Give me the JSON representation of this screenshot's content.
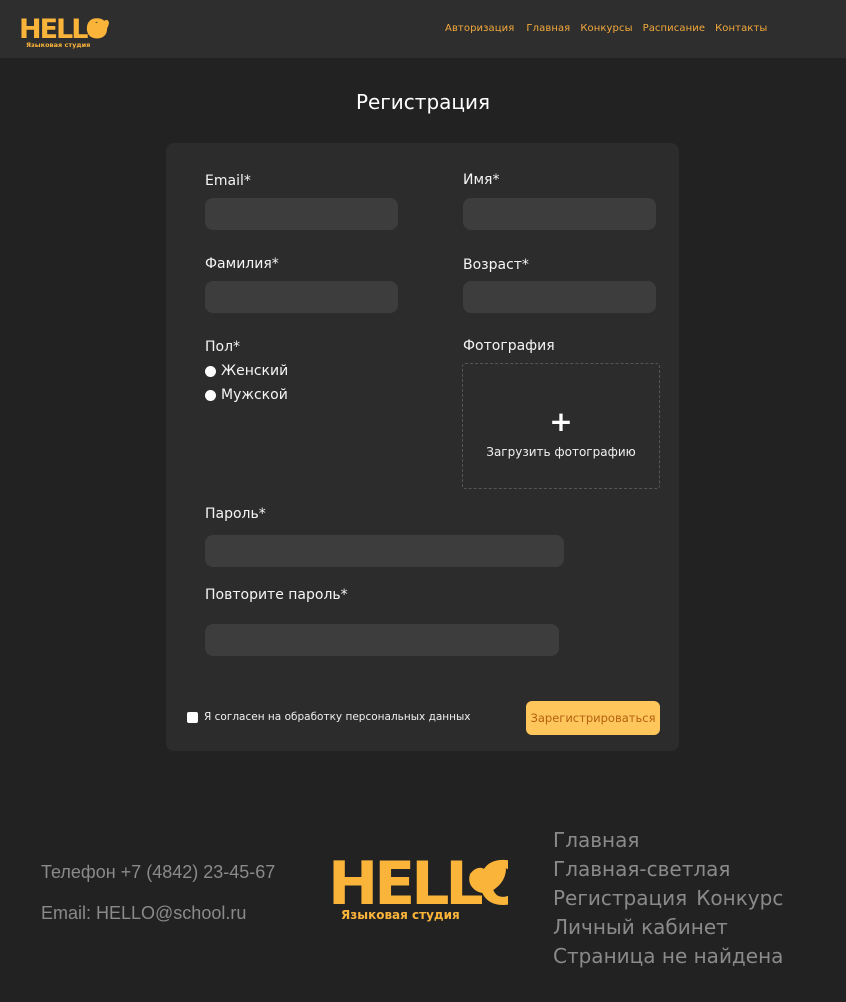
{
  "brand": {
    "logo_text": "HELLO",
    "logo_subtitle": "Языковая студия",
    "accent_color": "#f3a93c",
    "logo_color": "#fbb43a"
  },
  "nav": {
    "items": [
      {
        "label": "Авторизация"
      },
      {
        "label": "Главная"
      },
      {
        "label": "Конкурсы"
      },
      {
        "label": "Расписание"
      },
      {
        "label": "Контакты"
      }
    ]
  },
  "page": {
    "title": "Регистрация"
  },
  "form": {
    "email_label": "Email*",
    "email_value": "",
    "name_label": "Имя*",
    "name_value": "",
    "surname_label": "Фамилия*",
    "surname_value": "",
    "age_label": "Возраст*",
    "age_value": "",
    "gender_label": "Пол*",
    "gender_options": [
      {
        "label": "Женский"
      },
      {
        "label": "Мужской"
      }
    ],
    "photo_label": "Фотография",
    "photo_upload_icon": "+",
    "photo_upload_text": "Загрузить фотографию",
    "password_label": "Пароль*",
    "password_value": "",
    "password_repeat_label": "Повторите пароль*",
    "password_repeat_value": "",
    "consent_text": "Я согласен на обработку персональных данных",
    "submit_label": "Зарегистрироваться"
  },
  "footer": {
    "phone": "Телефон +7 (4842) 23-45-67",
    "email": "Email: HELLO@school.ru",
    "links": [
      {
        "label": "Главная"
      },
      {
        "label": "Главная-светлая"
      },
      {
        "label": "Регистрация"
      },
      {
        "label": "Конкурс"
      },
      {
        "label": "Личный кабинет"
      },
      {
        "label": "Страница не найдена"
      }
    ]
  }
}
